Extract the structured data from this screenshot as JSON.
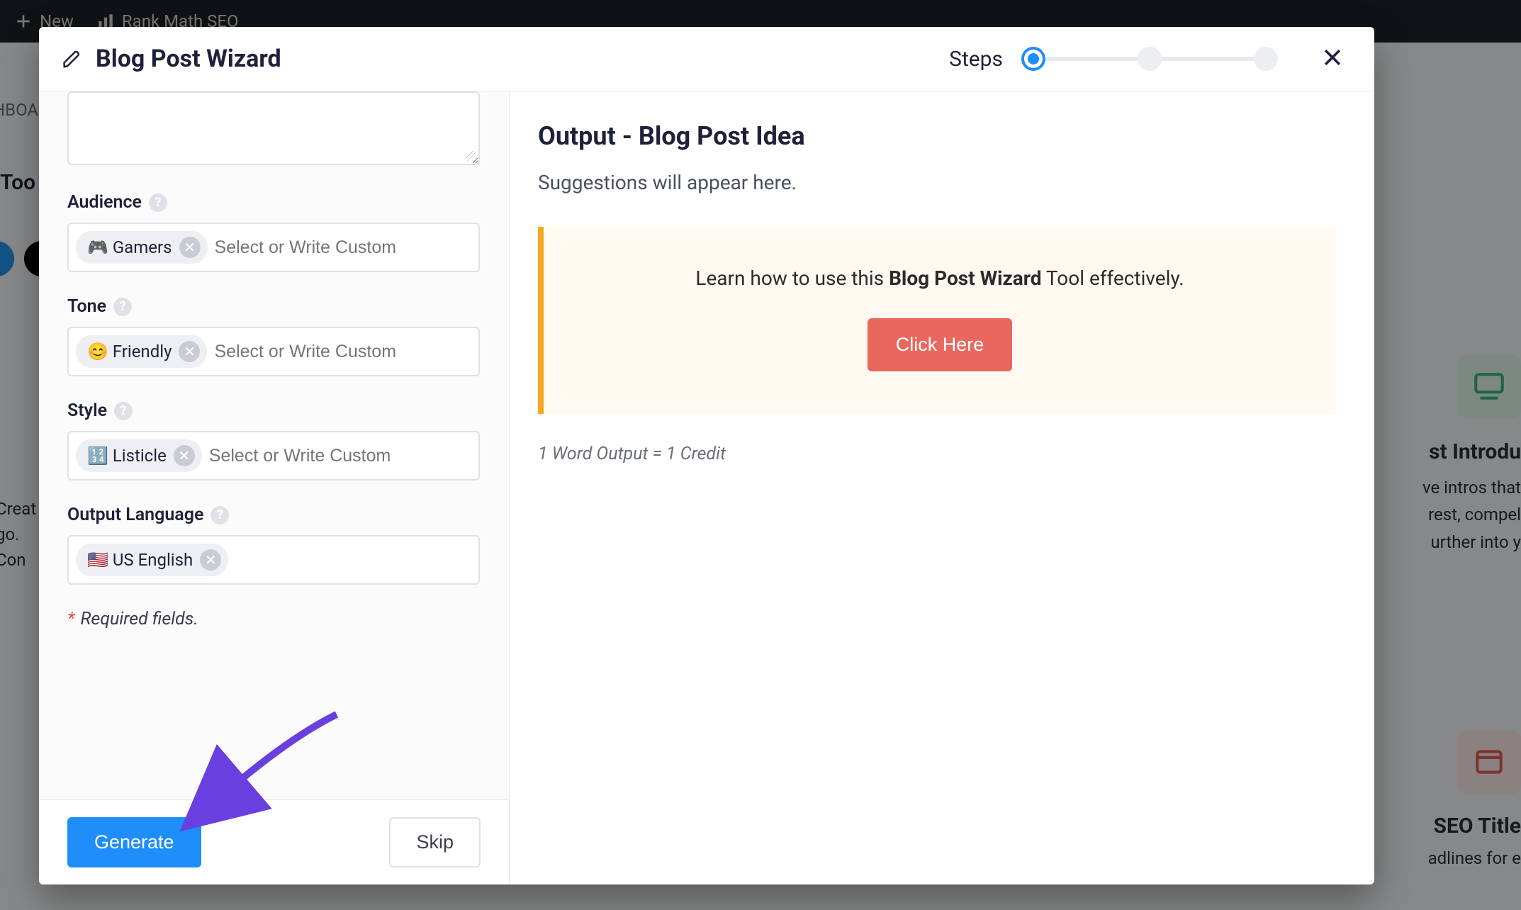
{
  "wp": {
    "new": "New",
    "rankmath": "Rank Math SEO"
  },
  "bg": {
    "toolbar_left": "HBOA",
    "toolbar_tools": "Too",
    "card1_title": "st Introdu",
    "card1_l1": "ve intros that",
    "card1_l2": "rest, compel",
    "card1_l3": "urther into y",
    "card2_title": "SEO Title",
    "card2_sub": "adlines for e",
    "creat1": "Creat",
    "creat2": "go.",
    "creat3": "Con"
  },
  "modal": {
    "title": "Blog Post Wizard",
    "steps_label": "Steps",
    "steps_active": 1,
    "steps_total": 3
  },
  "form": {
    "audience": {
      "label": "Audience",
      "tag_text": "🎮 Gamers",
      "placeholder": "Select or Write Custom"
    },
    "tone": {
      "label": "Tone",
      "tag_text": "😊 Friendly",
      "placeholder": "Select or Write Custom"
    },
    "style": {
      "label": "Style",
      "tag_text": "🔢 Listicle",
      "placeholder": "Select or Write Custom"
    },
    "lang": {
      "label": "Output Language",
      "tag_text": "🇺🇸 US English"
    },
    "required_note": "Required fields.",
    "generate": "Generate",
    "skip": "Skip"
  },
  "output": {
    "title": "Output - Blog Post Idea",
    "placeholder": "Suggestions will appear here.",
    "callout_pre": "Learn how to use this ",
    "callout_strong": "Blog Post Wizard",
    "callout_post": " Tool effectively.",
    "click_here": "Click Here",
    "credit_note": "1 Word Output = 1 Credit"
  }
}
